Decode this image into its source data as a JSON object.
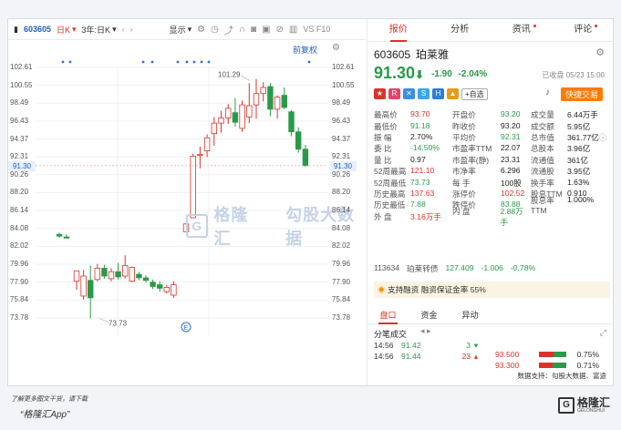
{
  "toolbar": {
    "code": "603605",
    "period": "日K",
    "range": "3年:日K",
    "display": "显示",
    "extra": "VS F10"
  },
  "chart": {
    "fuquan": "前复权",
    "y_ticks": [
      "102.61",
      "100.55",
      "98.49",
      "96.43",
      "94.37",
      "92.31",
      "90.26",
      "88.20",
      "86.14",
      "84.08",
      "82.02",
      "79.96",
      "77.90",
      "75.84",
      "73.78"
    ],
    "current_price": "91.30",
    "high_label": "101.29",
    "low_label": "73.73",
    "watermark": "格隆汇",
    "watermark2": "勾股大数据"
  },
  "chart_data": {
    "type": "candlestick",
    "title": "",
    "ylim": [
      73.78,
      102.61
    ],
    "candles": [
      {
        "o": 83.4,
        "h": 83.6,
        "l": 83.0,
        "c": 83.2
      },
      {
        "o": 83.1,
        "h": 83.4,
        "l": 82.9,
        "c": 83.0
      },
      {
        "o": 78.0,
        "h": 79.0,
        "l": 77.0,
        "c": 79.2
      },
      {
        "o": 76.3,
        "h": 79.3,
        "l": 75.9,
        "c": 78.6
      },
      {
        "o": 78.1,
        "h": 79.8,
        "l": 73.73,
        "c": 76.1
      },
      {
        "o": 78.2,
        "h": 80.0,
        "l": 78.0,
        "c": 79.5
      },
      {
        "o": 79.5,
        "h": 79.9,
        "l": 78.3,
        "c": 78.6
      },
      {
        "o": 78.3,
        "h": 79.5,
        "l": 78.0,
        "c": 79.1
      },
      {
        "o": 79.1,
        "h": 80.1,
        "l": 78.2,
        "c": 78.5
      },
      {
        "o": 78.6,
        "h": 81.0,
        "l": 78.3,
        "c": 79.8
      },
      {
        "o": 78.0,
        "h": 79.7,
        "l": 77.9,
        "c": 79.6
      },
      {
        "o": 78.8,
        "h": 79.1,
        "l": 78.1,
        "c": 78.4
      },
      {
        "o": 78.4,
        "h": 78.7,
        "l": 77.9,
        "c": 78.1
      },
      {
        "o": 77.9,
        "h": 78.2,
        "l": 77.1,
        "c": 77.4
      },
      {
        "o": 77.6,
        "h": 78.0,
        "l": 76.8,
        "c": 77.2
      },
      {
        "o": 76.8,
        "h": 77.6,
        "l": 76.6,
        "c": 77.3
      },
      {
        "o": 76.4,
        "h": 78.0,
        "l": 76.1,
        "c": 77.6
      },
      {
        "o": 83.7,
        "h": 84.6,
        "l": 83.7,
        "c": 84.6
      },
      {
        "o": 85.3,
        "h": 92.7,
        "l": 85.3,
        "c": 92.4
      },
      {
        "o": 92.5,
        "h": 93.5,
        "l": 91.0,
        "c": 92.6
      },
      {
        "o": 93.0,
        "h": 94.9,
        "l": 92.3,
        "c": 94.5
      },
      {
        "o": 95.0,
        "h": 96.9,
        "l": 93.6,
        "c": 96.2
      },
      {
        "o": 96.2,
        "h": 97.6,
        "l": 95.1,
        "c": 96.8
      },
      {
        "o": 96.8,
        "h": 98.4,
        "l": 96.1,
        "c": 97.9
      },
      {
        "o": 97.4,
        "h": 99.1,
        "l": 95.8,
        "c": 96.3
      },
      {
        "o": 95.6,
        "h": 98.8,
        "l": 95.2,
        "c": 98.3
      },
      {
        "o": 96.9,
        "h": 100.8,
        "l": 96.2,
        "c": 98.2
      },
      {
        "o": 98.3,
        "h": 101.29,
        "l": 96.7,
        "c": 99.6
      },
      {
        "o": 99.6,
        "h": 100.9,
        "l": 98.7,
        "c": 100.3
      },
      {
        "o": 100.4,
        "h": 100.8,
        "l": 97.0,
        "c": 97.8
      },
      {
        "o": 97.8,
        "h": 99.4,
        "l": 96.7,
        "c": 99.2
      },
      {
        "o": 99.4,
        "h": 100.3,
        "l": 97.8,
        "c": 98.0
      },
      {
        "o": 97.5,
        "h": 97.7,
        "l": 94.7,
        "c": 95.2
      },
      {
        "o": 95.2,
        "h": 95.7,
        "l": 92.8,
        "c": 93.2
      },
      {
        "o": 93.2,
        "h": 93.7,
        "l": 91.2,
        "c": 91.3
      }
    ]
  },
  "tabs": [
    "报价",
    "分析",
    "资讯",
    "评论"
  ],
  "stock": {
    "code": "603605",
    "name": "珀莱雅",
    "price": "91.30",
    "arrow": "⬇",
    "change": "-1.90",
    "pct": "-2.04%",
    "status": "已收盘 05/23 15:00",
    "self_select": "+自选",
    "fast_trade": "快捷交易"
  },
  "quote": [
    [
      [
        "最高价",
        "93.70",
        "up"
      ],
      [
        "开盘价",
        "93.20",
        "dn"
      ],
      [
        "成交量",
        "6.44万手",
        ""
      ]
    ],
    [
      [
        "最低价",
        "91.18",
        "dn"
      ],
      [
        "昨收价",
        "93.20",
        ""
      ],
      [
        "成交额",
        "5.95亿",
        ""
      ]
    ],
    [
      [
        "振 幅",
        "2.70%",
        ""
      ],
      [
        "平均价",
        "92.31",
        "dn"
      ],
      [
        "总市值",
        "361.77亿",
        ""
      ]
    ],
    [
      [
        "委 比",
        "-14.50%",
        "dn"
      ],
      [
        "市盈率TTM",
        "22.07",
        ""
      ],
      [
        "总股本",
        "3.96亿",
        ""
      ]
    ],
    [
      [
        "量 比",
        "0.97",
        ""
      ],
      [
        "市盈率(静)",
        "23.31",
        ""
      ],
      [
        "流通值",
        "361亿",
        ""
      ]
    ],
    [
      [
        "52周最高",
        "121.10",
        "up"
      ],
      [
        "市净率",
        "6.296",
        ""
      ],
      [
        "流通股",
        "3.95亿",
        ""
      ]
    ],
    [
      [
        "52周最低",
        "73.73",
        "dn"
      ],
      [
        "每 手",
        "100股",
        ""
      ],
      [
        "换手率",
        "1.63%",
        ""
      ]
    ],
    [
      [
        "历史最高",
        "137.63",
        "up"
      ],
      [
        "涨停价",
        "102.52",
        "up"
      ],
      [
        "股息TTM",
        "0.910",
        ""
      ]
    ],
    [
      [
        "历史最低",
        "7.88",
        "dn"
      ],
      [
        "跌停价",
        "83.88",
        "dn"
      ],
      [
        "股息率TTM",
        "1.000%",
        ""
      ]
    ],
    [
      [
        "外 盘",
        "3.16万手",
        "up"
      ],
      [
        "内 盘",
        "2.88万手",
        "dn"
      ],
      [
        "",
        "",
        ""
      ]
    ]
  ],
  "bond": {
    "code": "113634",
    "name": "珀莱转债",
    "price": "127.409",
    "change": "-1.006",
    "pct": "-0.78%"
  },
  "margin": "支持融资 融资保证金率 55%",
  "subtabs": [
    "盘口",
    "资金",
    "异动"
  ],
  "fenbi": {
    "title": "分笔成交",
    "trades": [
      {
        "time": "14:56",
        "price": "91.42",
        "vol": "3",
        "dir": "▾"
      },
      {
        "time": "14:56",
        "price": "91.44",
        "vol": "23",
        "dir": "▴"
      }
    ],
    "levels": [
      {
        "price": "93.500",
        "pct": "0.75%"
      },
      {
        "price": "93.300",
        "pct": "0.71%"
      }
    ]
  },
  "source": "数据支持：勾股大数据、富途",
  "footer": {
    "line1": "了解更多图文干货，请下载",
    "line2": "“格隆汇App”",
    "logo": "格隆汇",
    "logo_sub": "GELONGHUI"
  },
  "colors": {
    "up": "#d9342b",
    "down": "#2a9a4a",
    "accent": "#1f5fbf"
  }
}
